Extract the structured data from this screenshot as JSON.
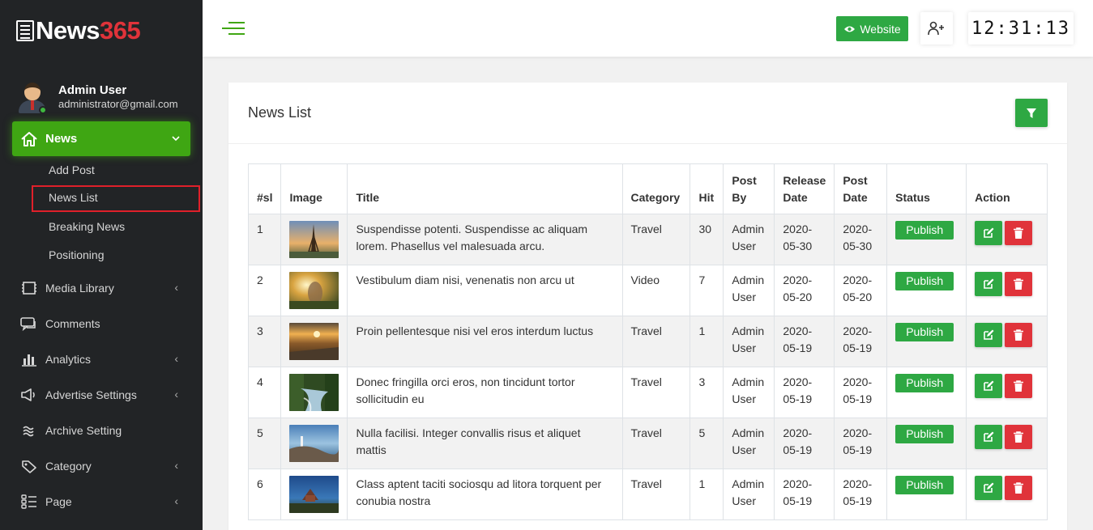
{
  "brand": {
    "name": "News",
    "num": "365"
  },
  "user": {
    "name": "Admin User",
    "email": "administrator@gmail.com"
  },
  "sidebar": {
    "active": {
      "label": "News"
    },
    "sub_items": [
      {
        "label": "Add Post"
      },
      {
        "label": "News List"
      },
      {
        "label": "Breaking News"
      },
      {
        "label": "Positioning"
      }
    ],
    "items": [
      {
        "label": "Media Library",
        "icon": "media-icon",
        "chevron": true
      },
      {
        "label": "Comments",
        "icon": "comments-icon",
        "chevron": false
      },
      {
        "label": "Analytics",
        "icon": "analytics-icon",
        "chevron": true
      },
      {
        "label": "Advertise Settings",
        "icon": "megaphone-icon",
        "chevron": true
      },
      {
        "label": "Archive Setting",
        "icon": "archive-icon",
        "chevron": false
      },
      {
        "label": "Category",
        "icon": "tag-icon",
        "chevron": true
      },
      {
        "label": "Page",
        "icon": "page-icon",
        "chevron": true
      }
    ]
  },
  "topbar": {
    "website_label": "Website",
    "clock": "12:31:13"
  },
  "card": {
    "title": "News List"
  },
  "table": {
    "headers": [
      "#sl",
      "Image",
      "Title",
      "Category",
      "Hit",
      "Post By",
      "Release Date",
      "Post Date",
      "Status",
      "Action"
    ],
    "rows": [
      {
        "sl": "1",
        "title": "Suspendisse potenti. Suspendisse ac aliquam lorem. Phasellus vel malesuada arcu.",
        "category": "Travel",
        "hit": "30",
        "post_by": "Admin User",
        "release": "2020-05-30",
        "post": "2020-05-30",
        "status": "Publish"
      },
      {
        "sl": "2",
        "title": "Vestibulum diam nisi, venenatis non arcu ut",
        "category": "Video",
        "hit": "7",
        "post_by": "Admin User",
        "release": "2020-05-20",
        "post": "2020-05-20",
        "status": "Publish"
      },
      {
        "sl": "3",
        "title": "Proin pellentesque nisi vel eros interdum luctus",
        "category": "Travel",
        "hit": "1",
        "post_by": "Admin User",
        "release": "2020-05-19",
        "post": "2020-05-19",
        "status": "Publish"
      },
      {
        "sl": "4",
        "title": "Donec fringilla orci eros, non tincidunt tortor sollicitudin eu",
        "category": "Travel",
        "hit": "3",
        "post_by": "Admin User",
        "release": "2020-05-19",
        "post": "2020-05-19",
        "status": "Publish"
      },
      {
        "sl": "5",
        "title": "Nulla facilisi. Integer convallis risus et aliquet mattis",
        "category": "Travel",
        "hit": "5",
        "post_by": "Admin User",
        "release": "2020-05-19",
        "post": "2020-05-19",
        "status": "Publish"
      },
      {
        "sl": "6",
        "title": "Class aptent taciti sociosqu ad litora torquent per conubia nostra",
        "category": "Travel",
        "hit": "1",
        "post_by": "Admin User",
        "release": "2020-05-19",
        "post": "2020-05-19",
        "status": "Publish"
      }
    ]
  },
  "colors": {
    "accent": "#3fa613",
    "button_green": "#2ea843",
    "danger": "#e0333a",
    "sidebar_bg": "#222426"
  }
}
